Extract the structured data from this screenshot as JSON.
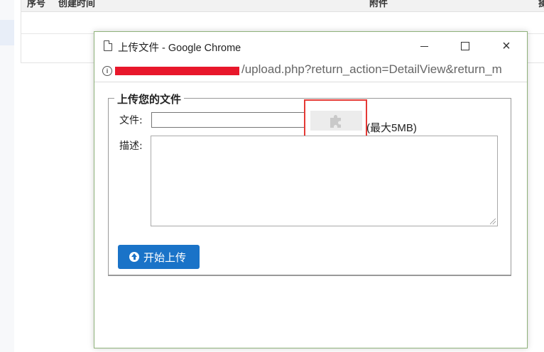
{
  "background": {
    "columns": [
      "序号",
      "创建时间",
      "附件",
      "操"
    ]
  },
  "window": {
    "title": "上传文件 - Google Chrome",
    "minimize_icon": "minimize-icon",
    "maximize_icon": "maximize-icon",
    "close_glyph": "×"
  },
  "address": {
    "url_visible": "/upload.php?return_action=DetailView&return_m"
  },
  "form": {
    "legend": "上传您的文件",
    "file_label": "文件:",
    "file_input_value": "",
    "max_size_text": "(最大5MB)",
    "desc_label": "描述:",
    "desc_value": "",
    "upload_button_label": "开始上传"
  },
  "colors": {
    "window_border": "#8fb27a",
    "button": "#1a73c8",
    "highlight": "#e53935",
    "redaction": "#e8172b"
  }
}
